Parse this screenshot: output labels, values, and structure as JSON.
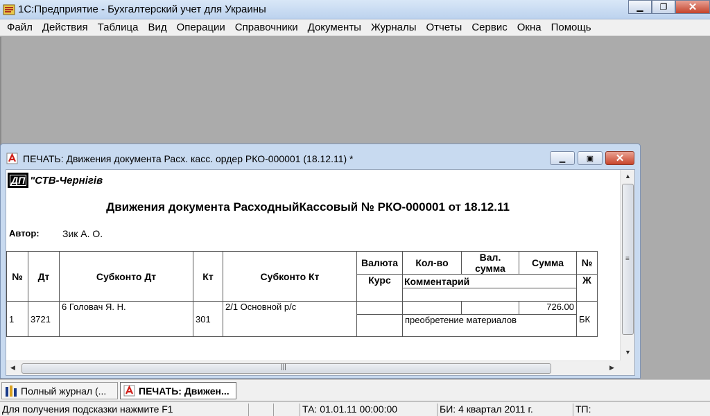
{
  "app": {
    "title": "1С:Предприятие - Бухгалтерский учет для Украины"
  },
  "menu": [
    "Файл",
    "Действия",
    "Таблица",
    "Вид",
    "Операции",
    "Справочники",
    "Документы",
    "Журналы",
    "Отчеты",
    "Сервис",
    "Окна",
    "Помощь"
  ],
  "window": {
    "title": "ПЕЧАТЬ: Движения документа Расх. касс. ордер РКО-000001 (18.12.11)  *"
  },
  "report": {
    "org_logo": "ДП",
    "org_name": "\"СТВ-Чернігів",
    "title": "Движения документа РасходныйКассовый № РКО-000001 от 18.12.11",
    "author_label": "Автор:",
    "author": "Зик А. О.",
    "headers": {
      "num": "№",
      "dt": "Дт",
      "subconto_dt": "Субконто Дт",
      "kt": "Кт",
      "subconto_kt": "Субконто Кт",
      "currency": "Валюта",
      "rate": "Курс",
      "qty": "Кол-во",
      "cur_sum": "Вал. сумма",
      "sum": "Сумма",
      "comment": "Комментарий",
      "journal_1": "№",
      "journal_2": "Ж"
    },
    "rows": [
      {
        "num": "1",
        "dt": "3721",
        "subconto_dt": "6 Головач Я. Н.",
        "kt": "301",
        "subconto_kt": "2/1 Основной р/с",
        "sum": "726.00",
        "comment": "преобретение материалов",
        "journal": "БК"
      }
    ]
  },
  "taskbar": {
    "items": [
      {
        "label": "Полный журнал (..."
      },
      {
        "label": "ПЕЧАТЬ: Движен..."
      }
    ]
  },
  "status": {
    "hint": "Для получения подсказки нажмите F1",
    "ta": "ТА: 01.01.11  00:00:00",
    "bi": "БИ: 4 квартал 2011 г.",
    "tp": "ТП:"
  }
}
